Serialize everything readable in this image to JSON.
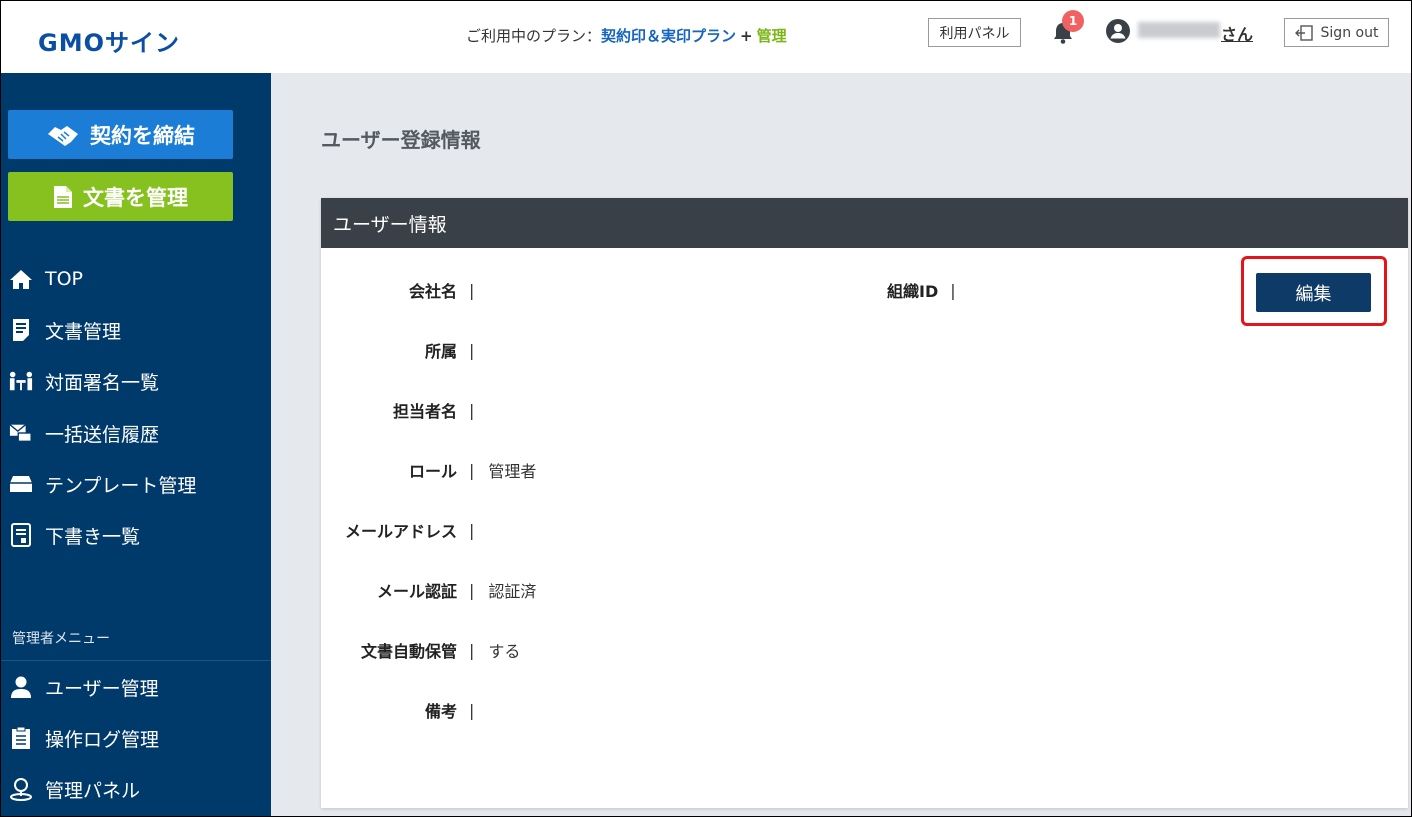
{
  "header": {
    "logo": "GMOサイン",
    "plan_prefix": "ご利用中のプラン：",
    "plan_name": "契約印＆実印プラン",
    "plan_plus": "+",
    "plan_admin": "管理",
    "panel_button": "利用パネル",
    "notification_count": "1",
    "user_suffix": "さん",
    "signout_label": "Sign out"
  },
  "sidebar": {
    "contract_button": "契約を締結",
    "docs_button": "文書を管理",
    "items": [
      {
        "label": "TOP",
        "icon": "home-icon"
      },
      {
        "label": "文書管理",
        "icon": "document-list-icon"
      },
      {
        "label": "対面署名一覧",
        "icon": "face-to-face-icon"
      },
      {
        "label": "一括送信履歴",
        "icon": "bulk-send-icon"
      },
      {
        "label": "テンプレート管理",
        "icon": "template-icon"
      },
      {
        "label": "下書き一覧",
        "icon": "draft-icon"
      }
    ],
    "admin_label": "管理者メニュー",
    "admin_items": [
      {
        "label": "ユーザー管理",
        "icon": "user-icon"
      },
      {
        "label": "操作ログ管理",
        "icon": "log-icon"
      },
      {
        "label": "管理パネル",
        "icon": "admin-panel-icon"
      }
    ]
  },
  "main": {
    "page_title": "ユーザー登録情報",
    "card_title": "ユーザー情報",
    "edit_button": "編集",
    "org_id_label": "組織ID",
    "org_id_value": "",
    "separator": "|",
    "fields": [
      {
        "label": "会社名",
        "value": ""
      },
      {
        "label": "所属",
        "value": ""
      },
      {
        "label": "担当者名",
        "value": ""
      },
      {
        "label": "ロール",
        "value": "管理者"
      },
      {
        "label": "メールアドレス",
        "value": ""
      },
      {
        "label": "メール認証",
        "value": "認証済"
      },
      {
        "label": "文書自動保管",
        "value": "する"
      },
      {
        "label": "備考",
        "value": ""
      }
    ]
  },
  "colors": {
    "sidebar_bg": "#003a6b",
    "contract_blue": "#1b7dd6",
    "docs_green": "#86c11f",
    "edit_button": "#0e3a67",
    "highlight_red": "#e5141a",
    "card_header": "#3a4047"
  }
}
